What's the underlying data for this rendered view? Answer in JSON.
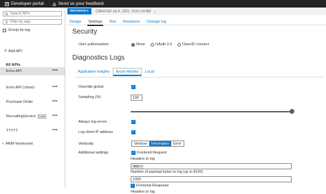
{
  "topbar": {
    "developer_portal": "Developer portal",
    "feedback": "Send us your feedback"
  },
  "sidebar": {
    "search_apis_placeholder": "Search APIs",
    "filter_tags_placeholder": "Filter by tags",
    "group_by_tag": "Group by tag",
    "add_api": "Add API",
    "all_apis": "All APIs",
    "apis": [
      {
        "name": "Echo API",
        "selected": true
      },
      {
        "name": "Echo API (clone)",
        "selected": false
      },
      {
        "name": "Purchase Order",
        "selected": false
      },
      {
        "name": "RecruitingService",
        "tag": "Load",
        "selected": false
      },
      {
        "name": "TTTTT",
        "selected": false
      }
    ],
    "arm_versionset": "ARM-Versionset"
  },
  "revision": {
    "badge": "REVISION 1",
    "created": "CREATED Jul 9, 2021, 10:51:14 AM"
  },
  "tabs": [
    "Design",
    "Settings",
    "Test",
    "Revisions",
    "Change log"
  ],
  "active_tab": "Settings",
  "security": {
    "title": "Security",
    "user_authorization_label": "User authorization",
    "options": [
      "None",
      "OAuth 2.0",
      "OpenID connect"
    ],
    "selected": "None"
  },
  "diagnostics": {
    "title": "Diagnostics Logs",
    "subtabs": [
      "Application Insights",
      "Azure Monitor",
      "Local"
    ],
    "active_subtab": "Azure Monitor",
    "override_global_label": "Override global",
    "sampling_label": "Sampling (%)",
    "sampling_value": "100",
    "always_log_errors_label": "Always log errors",
    "log_client_ip_label": "Log client IP address",
    "verbosity_label": "Verbosity",
    "verbosity_options": [
      "Verbose",
      "Information",
      "Error"
    ],
    "verbosity_selected": "Information",
    "additional_settings_label": "Additional settings",
    "frontend_request_label": "Frontend Request",
    "headers_to_log_label": "Headers to log",
    "headers_tag": "test",
    "payload_bytes_label": "Number of payload bytes to log (up to 8192)",
    "payload_bytes_value": "1000",
    "frontend_response_label": "Frontend Response",
    "headers_to_log_label_2": "Headers to log"
  },
  "colors": {
    "accent": "#0078d4",
    "topbar": "#242424",
    "selected_row": "#e1e1e1"
  }
}
